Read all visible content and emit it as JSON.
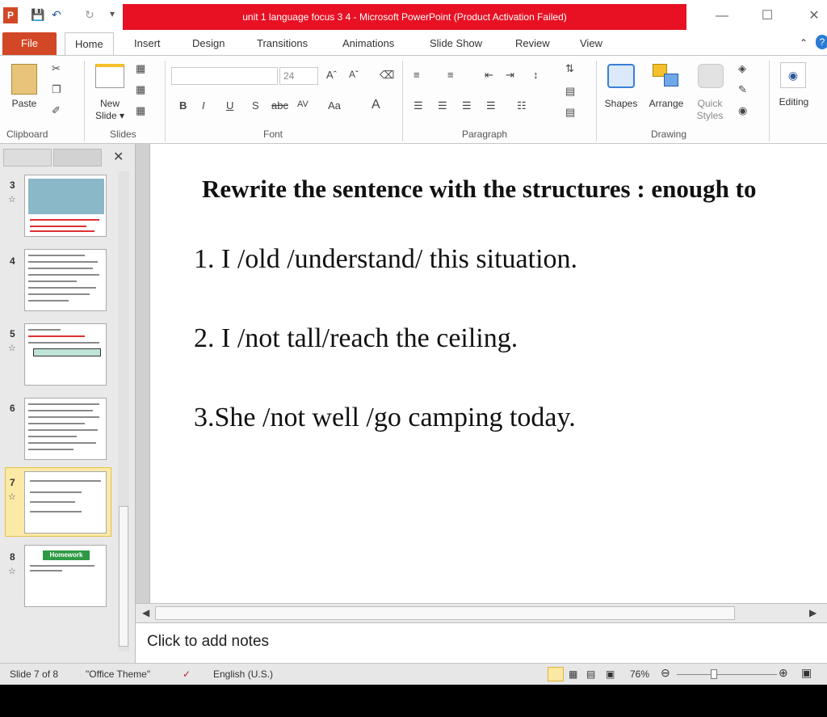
{
  "window": {
    "title": "unit 1 language focus 3 4 - Microsoft PowerPoint (Product Activation Failed)",
    "minimize": "—",
    "maximize": "☐",
    "close": "✕"
  },
  "ribbon_tabs": [
    "File",
    "Home",
    "Insert",
    "Design",
    "Transitions",
    "Animations",
    "Slide Show",
    "Review",
    "View"
  ],
  "ribbon": {
    "clipboard": {
      "paste": "Paste",
      "label": "Clipboard"
    },
    "slides": {
      "new_slide": "New",
      "new_slide2": "Slide ▾",
      "label": "Slides"
    },
    "font": {
      "size": "24",
      "bold": "B",
      "italic": "I",
      "underline": "U",
      "shadow": "S",
      "strike": "abc",
      "spacing": "AV",
      "case": "Aa",
      "color": "A",
      "label": "Font"
    },
    "paragraph": {
      "label": "Paragraph"
    },
    "drawing": {
      "shapes": "Shapes",
      "arrange": "Arrange",
      "quick": "Quick",
      "styles": "Styles",
      "label": "Drawing"
    },
    "editing": {
      "label": "Editing"
    }
  },
  "thumbnails": [
    {
      "num": "3"
    },
    {
      "num": "4"
    },
    {
      "num": "5"
    },
    {
      "num": "6"
    },
    {
      "num": "7"
    },
    {
      "num": "8",
      "heading": "Homework"
    }
  ],
  "slide": {
    "title": "Rewrite the sentence with the structures : enough to",
    "items": [
      "1.  I /old /understand/  this situation.",
      "2. I /not tall/reach the ceiling.",
      "3.She  /not well /go camping today."
    ]
  },
  "notes_placeholder": "Click to add notes",
  "status": {
    "slide_info": "Slide 7 of 8",
    "theme": "\"Office Theme\"",
    "language": "English (U.S.)",
    "zoom": "76%"
  }
}
